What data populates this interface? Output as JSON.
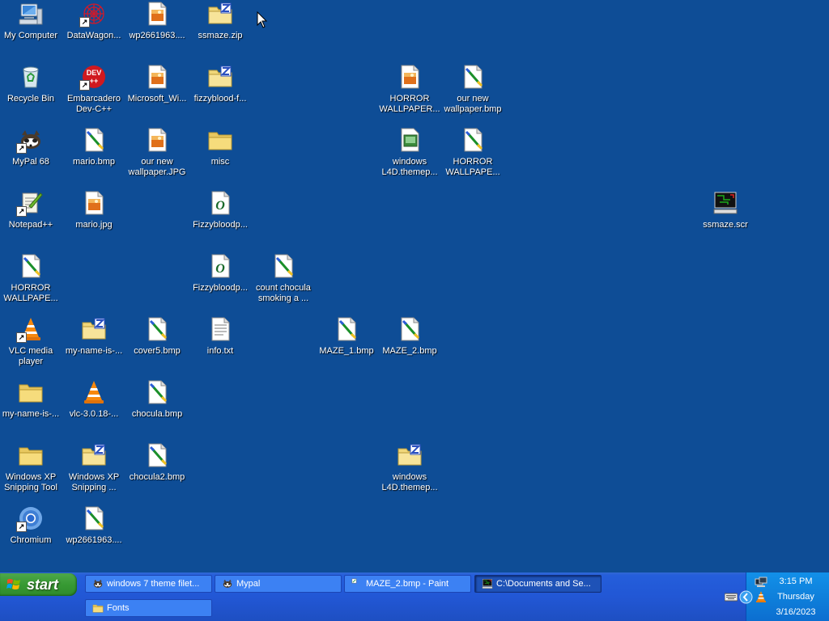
{
  "desktop": {
    "icons": [
      {
        "label": "My Computer",
        "icon": "my-computer-icon",
        "shortcut": false
      },
      {
        "label": "DataWagon...",
        "icon": "datawagon-icon",
        "shortcut": true
      },
      {
        "label": "wp2661963....",
        "icon": "jpeg-file-icon",
        "shortcut": false
      },
      {
        "label": "ssmaze.zip",
        "icon": "zip-folder-icon",
        "shortcut": false
      },
      {
        "label": "Recycle Bin",
        "icon": "recycle-bin-icon",
        "shortcut": false
      },
      {
        "label": "Embarcadero Dev-C++",
        "icon": "devcpp-icon",
        "shortcut": true
      },
      {
        "label": "Microsoft_Wi...",
        "icon": "jpeg-file-icon",
        "shortcut": false
      },
      {
        "label": "fizzyblood-f...",
        "icon": "zip-folder-icon",
        "shortcut": false
      },
      {
        "label": "HORROR WALLPAPER...",
        "icon": "jpeg-file-icon",
        "shortcut": false
      },
      {
        "label": "our new wallpaper.bmp",
        "icon": "bitmap-file-icon",
        "shortcut": false
      },
      {
        "label": "MyPal 68",
        "icon": "mypal-icon",
        "shortcut": true
      },
      {
        "label": "mario.bmp",
        "icon": "bitmap-file-icon",
        "shortcut": false
      },
      {
        "label": "our new wallpaper.JPG",
        "icon": "jpeg-file-icon",
        "shortcut": false
      },
      {
        "label": "misc",
        "icon": "folder-icon",
        "shortcut": false
      },
      {
        "label": "windows L4D.themep...",
        "icon": "theme-file-icon",
        "shortcut": false
      },
      {
        "label": "HORROR WALLPAPE...",
        "icon": "bitmap-file-icon",
        "shortcut": false
      },
      {
        "label": "Notepad++",
        "icon": "notepadpp-icon",
        "shortcut": true
      },
      {
        "label": "mario.jpg",
        "icon": "jpeg-file-icon",
        "shortcut": false
      },
      {
        "label": "Fizzybloodp...",
        "icon": "font-file-icon",
        "shortcut": false
      },
      {
        "label": "ssmaze.scr",
        "icon": "screensaver-icon",
        "shortcut": false
      },
      {
        "label": "HORROR WALLPAPE...",
        "icon": "bitmap-file-icon",
        "shortcut": false
      },
      {
        "label": "Fizzybloodp...",
        "icon": "font-file-icon",
        "shortcut": false
      },
      {
        "label": "count chocula smoking a ...",
        "icon": "bitmap-file-icon",
        "shortcut": false
      },
      {
        "label": "VLC media player",
        "icon": "vlc-icon",
        "shortcut": true
      },
      {
        "label": "my-name-is-...",
        "icon": "zip-folder-icon",
        "shortcut": false
      },
      {
        "label": "cover5.bmp",
        "icon": "bitmap-file-icon",
        "shortcut": false
      },
      {
        "label": "info.txt",
        "icon": "text-file-icon",
        "shortcut": false
      },
      {
        "label": "MAZE_1.bmp",
        "icon": "bitmap-file-icon",
        "shortcut": false
      },
      {
        "label": "MAZE_2.bmp",
        "icon": "bitmap-file-icon",
        "shortcut": false
      },
      {
        "label": "my-name-is-...",
        "icon": "folder-icon",
        "shortcut": false
      },
      {
        "label": "vlc-3.0.18-...",
        "icon": "vlc-icon",
        "shortcut": false
      },
      {
        "label": "chocula.bmp",
        "icon": "bitmap-file-icon",
        "shortcut": false
      },
      {
        "label": "Windows XP Snipping Tool",
        "icon": "folder-icon",
        "shortcut": false
      },
      {
        "label": "Windows XP Snipping ...",
        "icon": "zip-folder-icon",
        "shortcut": false
      },
      {
        "label": "chocula2.bmp",
        "icon": "bitmap-file-icon",
        "shortcut": false
      },
      {
        "label": "windows L4D.themep...",
        "icon": "zip-folder-icon",
        "shortcut": false
      },
      {
        "label": "Chromium",
        "icon": "chromium-icon",
        "shortcut": true
      },
      {
        "label": "wp2661963....",
        "icon": "bitmap-file-icon",
        "shortcut": false
      }
    ]
  },
  "taskbar": {
    "start_label": "start",
    "tasks": [
      {
        "label": "windows 7 theme filet...",
        "icon": "mypal-icon",
        "active": false
      },
      {
        "label": "Mypal",
        "icon": "mypal-icon",
        "active": false
      },
      {
        "label": "MAZE_2.bmp - Paint",
        "icon": "paint-icon",
        "active": false
      },
      {
        "label": "C:\\Documents and Se...",
        "icon": "screensaver-icon",
        "active": true
      },
      {
        "label": "Fonts",
        "icon": "folder-icon",
        "active": false
      }
    ],
    "tray": {
      "time": "3:15 PM",
      "day": "Thursday",
      "date": "3/16/2023",
      "icons": [
        "network-icon",
        "keyboard-icon",
        "show-hidden-icons-icon",
        "vlc-icon"
      ]
    }
  }
}
